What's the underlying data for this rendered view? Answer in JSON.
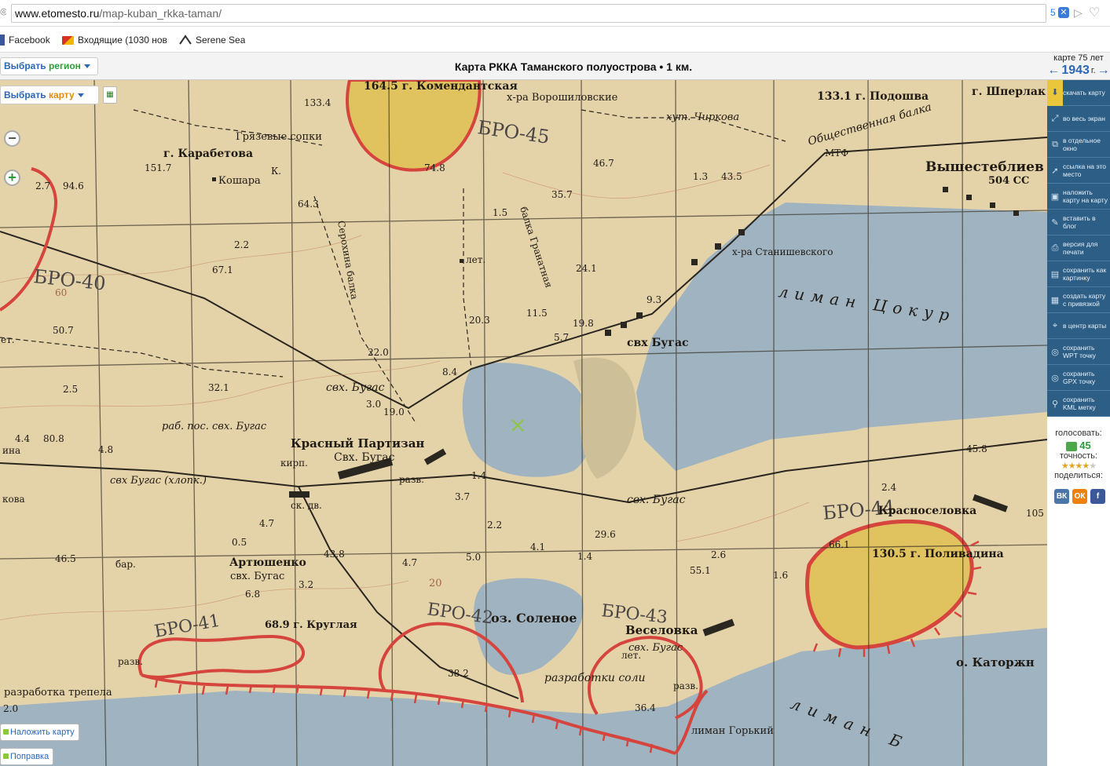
{
  "browser": {
    "url_domain": "www.etomesto.ru",
    "url_path": "/map-kuban_rkka-taman/",
    "addon_count": "5"
  },
  "bookmarks": [
    {
      "label": "Facebook",
      "icon": "facebook-icon"
    },
    {
      "label": "Входящие (1030 нов",
      "icon": "gmail-icon"
    },
    {
      "label": "Serene Sea",
      "icon": "serene-sea-icon"
    }
  ],
  "header": {
    "region_btn": {
      "prefix": "Выбрать",
      "accent": "регион"
    },
    "map_btn": {
      "prefix": "Выбрать",
      "accent": "карту"
    },
    "title": "Карта РККА Таманского полуострова • 1 км.",
    "years_label": "карте 75 лет",
    "year": "1943",
    "year_suffix": "г."
  },
  "toolbar": [
    {
      "label": "скачать карту",
      "icon": "download-icon",
      "active": true
    },
    {
      "label": "во весь экран",
      "icon": "fullscreen-icon"
    },
    {
      "label": "в отдельное окно",
      "icon": "new-window-icon"
    },
    {
      "label": "ссылка на это место",
      "icon": "link-icon"
    },
    {
      "label": "наложить карту на карту",
      "icon": "overlay-icon"
    },
    {
      "label": "вставить в блог",
      "icon": "embed-icon"
    },
    {
      "label": "версия для печати",
      "icon": "print-icon"
    },
    {
      "label": "сохранить как картинку",
      "icon": "save-image-icon"
    },
    {
      "label": "создать карту с привязкой",
      "icon": "grid-icon"
    },
    {
      "label": "в центр карты",
      "icon": "center-icon"
    },
    {
      "label": "сохранить WPT точку",
      "icon": "wpt-icon"
    },
    {
      "label": "сохранить GPX точку",
      "icon": "gpx-icon"
    },
    {
      "label": "сохранить KML метку",
      "icon": "kml-icon"
    }
  ],
  "vote": {
    "label": "голосовать:",
    "count": "45",
    "accuracy_label": "точность:",
    "rating": 4,
    "share_label": "поделиться:"
  },
  "share": [
    "ВК",
    "ОК",
    "f"
  ],
  "map_overlay": {
    "overlay_btn": "Наложить карту",
    "correction_btn": "Поправка"
  },
  "map_labels": {
    "l1": "164.5 г. Комендантская",
    "l2": "х-ра Ворошиловские",
    "l3": "БРО-45",
    "l4": "133.1 г. Подошва",
    "l5": "г. Шперлак",
    "l6": "133.4",
    "l7": "Грязевые сопки",
    "l8": "г. Карабетова",
    "l9": "хут. Чиркова",
    "l10": "Общественная балка",
    "l11": "151.7",
    "l12": "74.8",
    "l13": "46.7",
    "l14": "1.3",
    "l15": "43.5",
    "l16": "МТФ",
    "l17": "Вышестеблиев",
    "l18": "504 СС",
    "l19": "Кошара",
    "l20": "2.7",
    "l21": "94.6",
    "l22": "64.3",
    "l23": "35.7",
    "l24": "Серохина балка",
    "l25": "балка Гранатная",
    "l26": "х-ра Станишевского",
    "l27": "БРО-40",
    "l28": "67.1",
    "l29": "2.2",
    "l30": "1.5",
    "l31": "лет.",
    "l32": "24.1",
    "l33": "лиман Цокур",
    "l34": "9.3",
    "l35": "50.7",
    "l36": "20.3",
    "l37": "11.5",
    "l38": "19.8",
    "l39": "5.7",
    "l40": "свх Бугас",
    "l41": "22.0",
    "l42": "8.4",
    "l43": "2.5",
    "l44": "32.1",
    "l45": "свх. Бугас",
    "l46": "3.0",
    "l47": "19.0",
    "l48": "раб. пос. свх. Бугас",
    "l49": "4.4",
    "l50": "80.8",
    "l51": "4.8",
    "l52": "Красный Партизан",
    "l53": "Свх. Бугас",
    "l54": "45.8",
    "l55": "свх Бугас (хлопк.)",
    "l56": "кирп.",
    "l57": "разв.",
    "l58": "1.4",
    "l59": "2.4",
    "l60": "3.7",
    "l61": "ск. дв.",
    "l62": "свх. Бугас",
    "l63": "БРО-44",
    "l64": "Красноселовка",
    "l65": "105",
    "l66": "4.7",
    "l67": "2.2",
    "l68": "29.6",
    "l69": "66.1",
    "l70": "130.5 г. Поливадина",
    "l71": "0.5",
    "l72": "43.8",
    "l73": "4.1",
    "l74": "1.4",
    "l75": "2.6",
    "l76": "46.5",
    "l77": "Артюшенко",
    "l78": "свх. Бугас",
    "l79": "4.7",
    "l80": "5.0",
    "l81": "55.1",
    "l82": "1.6",
    "l83": "3.2",
    "l84": "6.8",
    "l85": "20",
    "l86": "БРО-41",
    "l87": "68.9 г. Круглая",
    "l88": "БРО-42",
    "l89": "оз. Соленое",
    "l90": "БРО-43",
    "l91": "Веселовка",
    "l92": "свх. Бугас",
    "l93": "лет.",
    "l94": "о. Каторжн",
    "l95": "38.2",
    "l96": "разработки соли",
    "l97": "36.4",
    "l98": "разв.",
    "l99": "разработка трепела",
    "l100": "лиман Горький",
    "l101": "лиман Б",
    "l102": "2.0",
    "l103": "ина",
    "l104": "кова",
    "l105": "ет.",
    "l106": "бар.",
    "l107": "разв.",
    "l108": "60",
    "l109": "К."
  },
  "colors": {
    "paper": "#e4d2a8",
    "water": "#9fb3c1",
    "red_boundary": "#d6453d",
    "toolbar": "#2c5e86",
    "link": "#2b67b5"
  }
}
